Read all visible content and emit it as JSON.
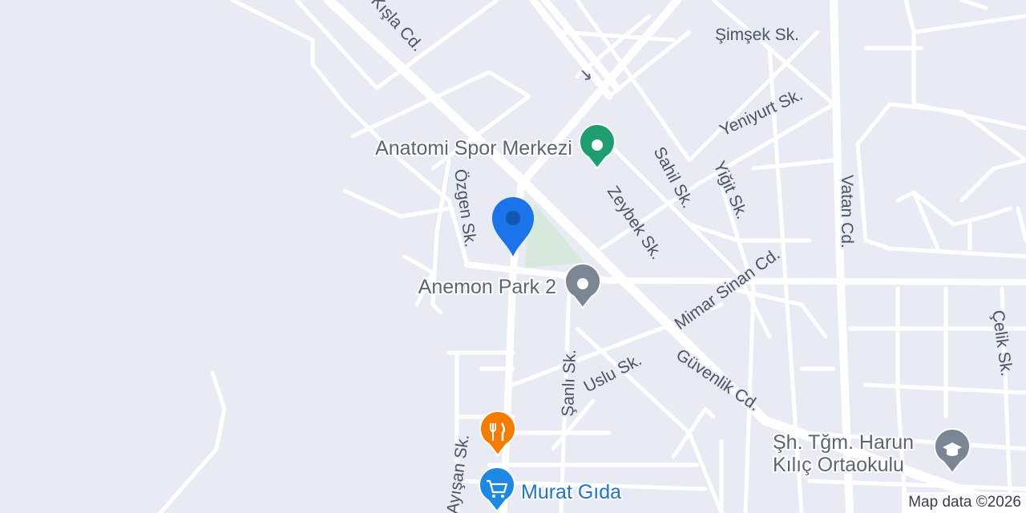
{
  "map": {
    "streets": [
      {
        "id": "kisla",
        "label": "Kışla Cd."
      },
      {
        "id": "simsek",
        "label": "Şimşek Sk."
      },
      {
        "id": "yeniyurt",
        "label": "Yeniyurt Sk."
      },
      {
        "id": "sahil",
        "label": "Sahil Sk."
      },
      {
        "id": "yigit",
        "label": "Yiğit Sk."
      },
      {
        "id": "vatan",
        "label": "Vatan Cd."
      },
      {
        "id": "zeybek",
        "label": "Zeybek Sk."
      },
      {
        "id": "ozgen",
        "label": "Özgen Sk."
      },
      {
        "id": "mimar-sinan",
        "label": "Mimar Sinan Cd."
      },
      {
        "id": "uslu",
        "label": "Uslu Sk."
      },
      {
        "id": "sanli",
        "label": "Şanlı Sk."
      },
      {
        "id": "guvenlik",
        "label": "Güvenlik Cd."
      },
      {
        "id": "celik",
        "label": "Çelik Sk."
      },
      {
        "id": "ayisan",
        "label": "Ayışan Sk."
      }
    ],
    "pois": [
      {
        "id": "anatomi",
        "label": "Anatomi Spor Merkezi",
        "icon": "location-pin-icon",
        "color": "#1e9e6e"
      },
      {
        "id": "anemon",
        "label": "Anemon Park 2",
        "icon": "location-pin-icon",
        "color": "#7a8693"
      },
      {
        "id": "okul",
        "label_line1": "Şh. Tğm. Harun",
        "label_line2": "Kılıç Ortaokulu",
        "icon": "graduation-cap-icon",
        "color": "#7a8693"
      },
      {
        "id": "murat",
        "label": "Murat Gıda",
        "icon": "shopping-cart-icon",
        "color": "#1e88e5"
      },
      {
        "id": "restaurant",
        "label": "",
        "icon": "fork-knife-icon",
        "color": "#f57c00"
      }
    ],
    "selected_marker": {
      "icon": "map-marker-icon",
      "color": "#1a73e8"
    },
    "park_color": "#d7e9dc",
    "attribution": "Map data ©2026"
  }
}
